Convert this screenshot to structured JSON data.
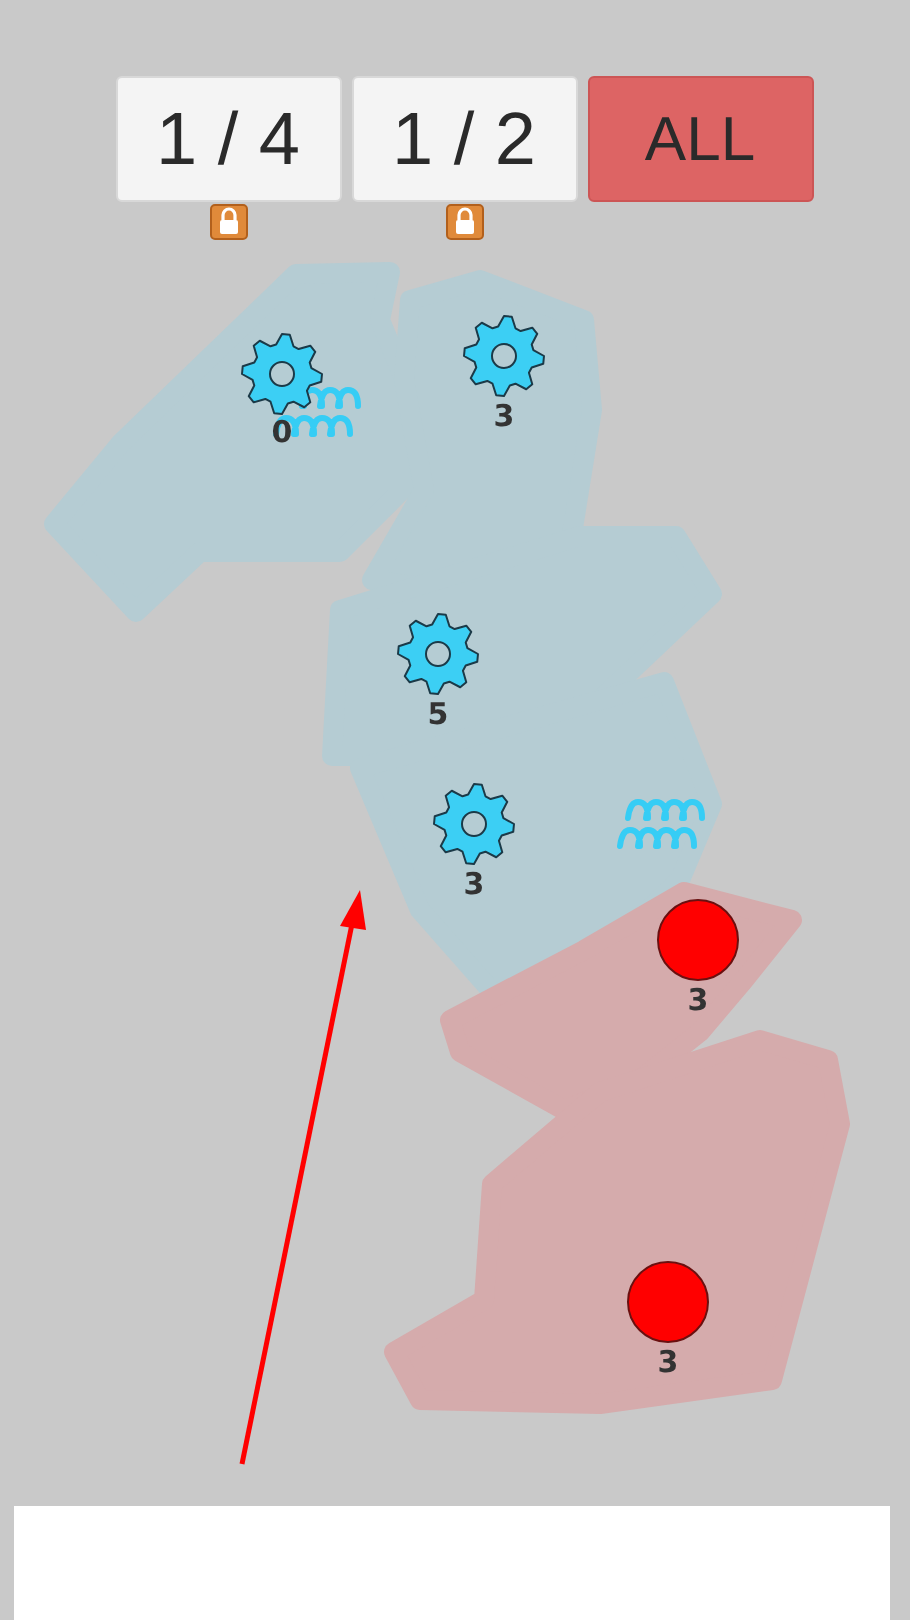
{
  "counters": [
    {
      "label": "1 / 4",
      "locked": true
    },
    {
      "label": "1 / 2",
      "locked": true
    }
  ],
  "all_button": {
    "label": "ALL"
  },
  "units": [
    {
      "kind": "gear",
      "count": "0"
    },
    {
      "kind": "gear",
      "count": "3"
    },
    {
      "kind": "gear",
      "count": "5"
    },
    {
      "kind": "gear",
      "count": "3"
    },
    {
      "kind": "dot",
      "count": "3"
    },
    {
      "kind": "dot",
      "count": "3"
    }
  ]
}
